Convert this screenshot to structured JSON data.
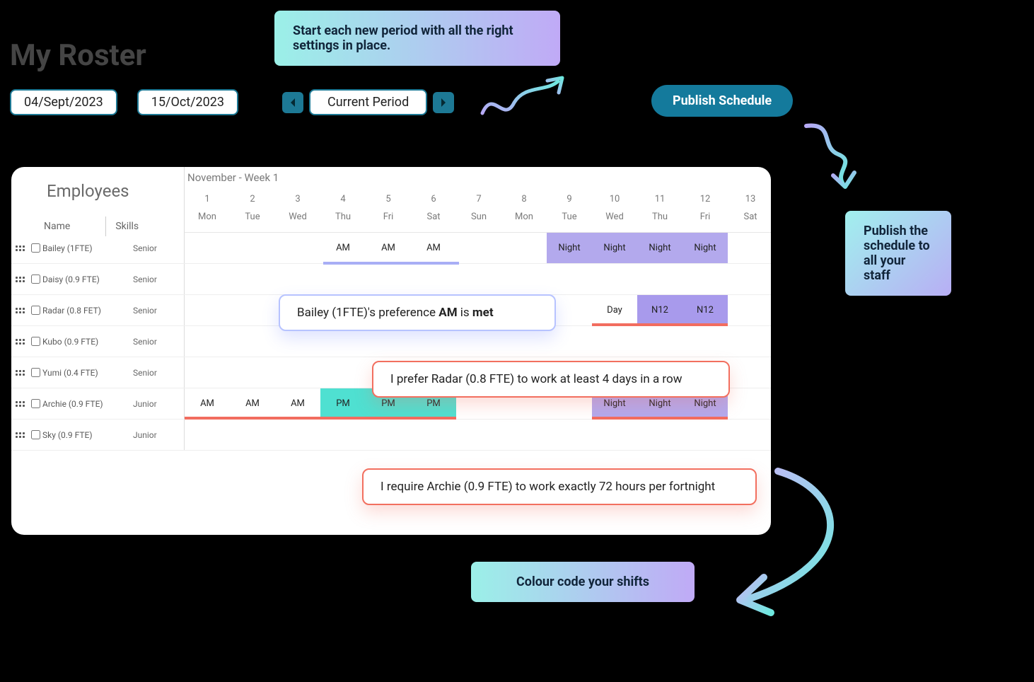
{
  "title": "My Roster",
  "controls": {
    "date_from": "04/Sept/2023",
    "date_to": "15/Oct/2023",
    "period_label": "Current Period"
  },
  "publish_label": "Publish Schedule",
  "tips": {
    "start": "Start each new period with all the right settings in place.",
    "publish": "Publish the schedule to all your staff",
    "colour": "Colour code your shifts"
  },
  "roster": {
    "employees_header": "Employees",
    "name_header": "Name",
    "skills_header": "Skills",
    "month_label": "November - Week 1",
    "day_numbers": [
      "1",
      "2",
      "3",
      "4",
      "5",
      "6",
      "7",
      "8",
      "9",
      "10",
      "11",
      "12",
      "13"
    ],
    "day_names": [
      "Mon",
      "Tue",
      "Wed",
      "Thu",
      "Fri",
      "Sat",
      "Sun",
      "Mon",
      "Tue",
      "Wed",
      "Thu",
      "Fri",
      "Sat"
    ],
    "rows": [
      {
        "name": "Bailey (1FTE)",
        "skill": "Senior"
      },
      {
        "name": "Daisy (0.9 FTE)",
        "skill": "Senior"
      },
      {
        "name": "Radar (0.8 FET)",
        "skill": "Senior"
      },
      {
        "name": "Kubo (0.9 FTE)",
        "skill": "Senior"
      },
      {
        "name": "Yumi (0.4 FTE)",
        "skill": "Senior"
      },
      {
        "name": "Archie (0.9 FTE)",
        "skill": "Junior"
      },
      {
        "name": "Sky (0.9 FTE)",
        "skill": "Junior"
      }
    ],
    "shift_labels": {
      "am": "AM",
      "pm": "PM",
      "night": "Night",
      "n12": "N12",
      "day": "Day"
    }
  },
  "callouts": {
    "preference_prefix": "Bailey (1FTE)'s preference ",
    "preference_shift": "AM",
    "preference_mid": " is ",
    "preference_status": "met",
    "rule_radar": "I prefer Radar (0.8 FTE) to work at least 4 days in a row",
    "rule_archie": "I require Archie (0.9 FTE) to work exactly 72 hours per fortnight"
  }
}
